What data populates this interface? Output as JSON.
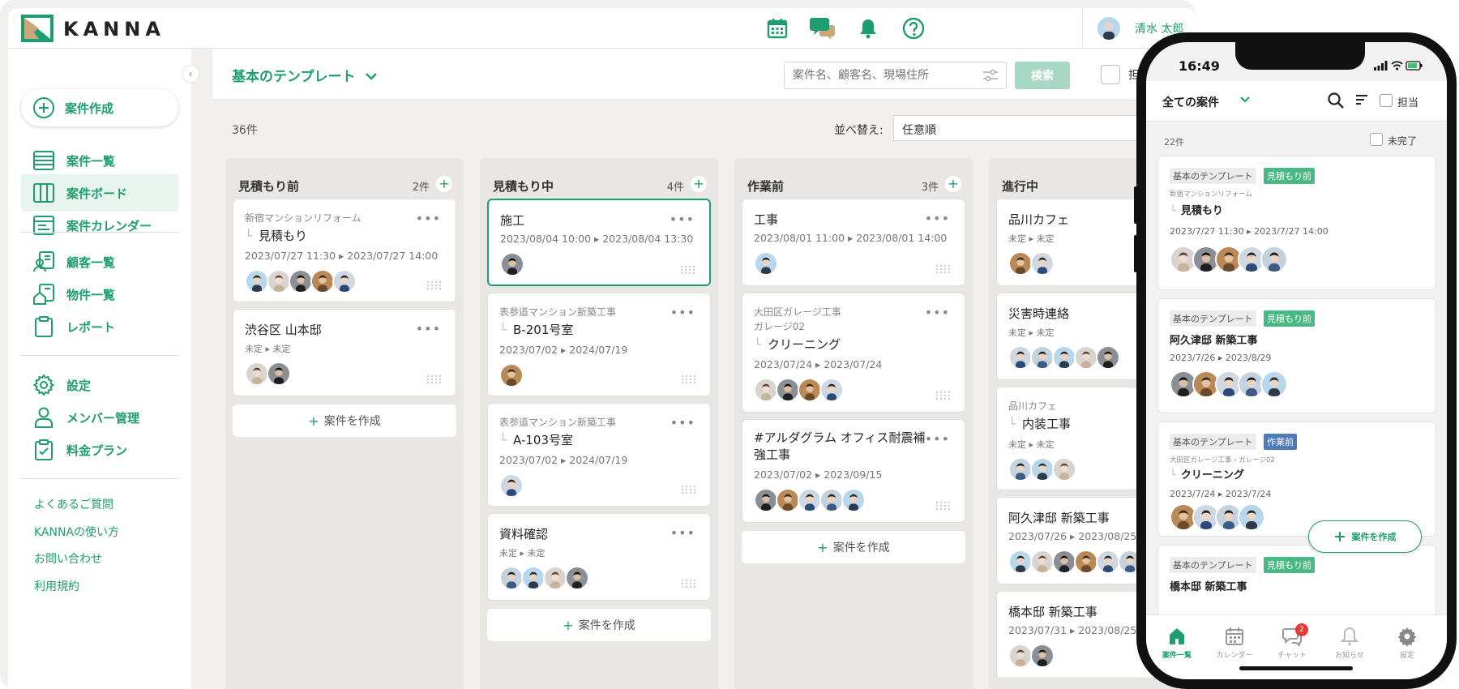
{
  "app": {
    "logo_text": "KANNA",
    "user_name": "清水 太郎"
  },
  "sidebar": {
    "create_label": "案件作成",
    "items": [
      {
        "label": "案件一覧",
        "icon": "list-icon"
      },
      {
        "label": "案件ボード",
        "icon": "board-icon",
        "active": true
      },
      {
        "label": "案件カレンダー",
        "icon": "calendar-list-icon"
      },
      {
        "label": "顧客一覧",
        "icon": "customer-icon"
      },
      {
        "label": "物件一覧",
        "icon": "property-icon"
      },
      {
        "label": "レポート",
        "icon": "report-icon"
      },
      {
        "label": "設定",
        "icon": "gear-icon"
      },
      {
        "label": "メンバー管理",
        "icon": "member-icon"
      },
      {
        "label": "料金プラン",
        "icon": "plan-icon"
      }
    ],
    "footer_links": [
      "よくあるご質問",
      "KANNAの使い方",
      "お問い合わせ",
      "利用規約"
    ]
  },
  "header": {
    "template_title": "基本のテンプレート",
    "search_placeholder": "案件名、顧客名、現場住所",
    "search_button": "検索",
    "assignee_label": "担"
  },
  "board": {
    "total_count": "36件",
    "sort_label": "並べ替え:",
    "sort_value": "任意順",
    "add_card_label": "案件を作成",
    "columns": [
      {
        "title": "見積もり前",
        "count": "2件",
        "cards": [
          {
            "sub": "新宿マンションリフォーム",
            "title": "見積もり",
            "dates": "2023/07/27 11:30 ▸ 2023/07/27 14:00",
            "avatars": 5
          },
          {
            "sub": "",
            "title": "渋谷区 山本邸",
            "dates": "未定 ▸ 未定",
            "avatars": 2
          }
        ]
      },
      {
        "title": "見積もり中",
        "count": "4件",
        "cards": [
          {
            "sub": "",
            "title": "施工",
            "dates": "2023/08/04 10:00 ▸ 2023/08/04 13:30",
            "avatars": 1
          },
          {
            "sub": "表参道マンション新築工事",
            "title": "B-201号室",
            "dates": "2023/07/02 ▸ 2024/07/19",
            "avatars": 1
          },
          {
            "sub": "表参道マンション新築工事",
            "title": "A-103号室",
            "dates": "2023/07/02 ▸ 2024/07/19",
            "avatars": 1
          },
          {
            "sub": "",
            "title": "資料確認",
            "dates": "未定 ▸ 未定",
            "avatars": 4
          }
        ]
      },
      {
        "title": "作業前",
        "count": "3件",
        "cards": [
          {
            "sub": "",
            "title": "工事",
            "dates": "2023/08/01 11:00 ▸ 2023/08/01 14:00",
            "avatars": 1
          },
          {
            "sub": "大田区ガレージ工事",
            "sub2": "ガレージ02",
            "title": "クリーニング",
            "dates": "2023/07/24 ▸ 2023/07/24",
            "avatars": 4
          },
          {
            "sub": "",
            "title": "#アルダグラム オフィス耐震補",
            "title2": "強工事",
            "dates": "2023/07/02 ▸ 2023/09/15",
            "avatars": 5
          }
        ]
      },
      {
        "title": "進行中",
        "count": "",
        "cards": [
          {
            "sub": "",
            "title": "品川カフェ",
            "dates": "未定 ▸ 未定",
            "avatars": 2
          },
          {
            "sub": "",
            "title": "災害時連絡",
            "dates": "未定 ▸ 未定",
            "avatars": 5
          },
          {
            "sub": "品川カフェ",
            "title": "内装工事",
            "dates": "未定 ▸ 未定",
            "avatars": 3
          },
          {
            "sub": "",
            "title": "阿久津邸 新築工事",
            "dates": "2023/07/26 ▸ 2023/08/25",
            "avatars": 6
          },
          {
            "sub": "",
            "title": "橋本邸 新築工事",
            "dates": "2023/07/31 ▸ 2023/08/25",
            "avatars": 2
          }
        ]
      }
    ]
  },
  "phone": {
    "time": "16:49",
    "header_title": "全ての案件",
    "assignee_label": "担当",
    "count": "22件",
    "incomplete_label": "未完了",
    "fab_label": "案件を作成",
    "cards": [
      {
        "tag1": "基本のテンプレート",
        "tag2": "見積もり前",
        "tag2_color": "#48b984",
        "sub": "新宿マンションリフォーム",
        "title": "見積もり",
        "dates": "2023/7/27 11:30 ▸ 2023/7/27 14:00"
      },
      {
        "tag1": "基本のテンプレート",
        "tag2": "見積もり前",
        "tag2_color": "#48b984",
        "sub": "",
        "title": "阿久津邸 新築工事",
        "dates": "2023/7/26 ▸ 2023/8/29"
      },
      {
        "tag1": "基本のテンプレート",
        "tag2": "作業前",
        "tag2_color": "#4e7bb8",
        "sub": "大田区ガレージ工事 › ガレージ02",
        "title": "クリーニング",
        "dates": "2023/7/24 ▸ 2023/7/24"
      },
      {
        "tag1": "基本のテンプレート",
        "tag2": "見積もり前",
        "tag2_color": "#48b984",
        "sub": "",
        "title": "橋本邸 新築工事",
        "dates": ""
      }
    ],
    "tabs": [
      {
        "label": "案件一覧",
        "icon": "home-icon"
      },
      {
        "label": "カレンダー",
        "icon": "calendar-icon"
      },
      {
        "label": "チャット",
        "icon": "chat-icon"
      },
      {
        "label": "お知らせ",
        "icon": "bell-icon"
      },
      {
        "label": "設定",
        "icon": "gear-icon"
      }
    ],
    "chat_badge": "2"
  },
  "colors": {
    "brand": "#1e9d6e",
    "accent_tan": "#c9a77a"
  }
}
